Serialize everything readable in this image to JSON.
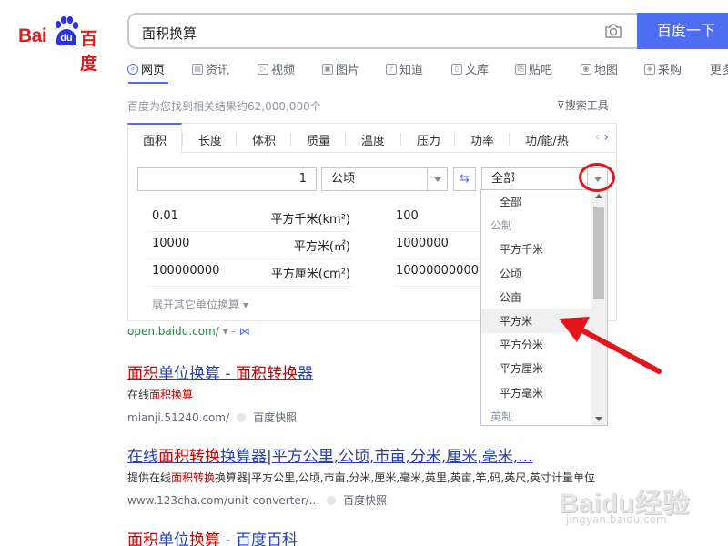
{
  "logo": {
    "bai": "Bai",
    "du": "du",
    "cn": "百度"
  },
  "search": {
    "query": "面积换算",
    "button": "百度一下"
  },
  "nav": [
    {
      "label": "网页",
      "active": true
    },
    {
      "label": "资讯"
    },
    {
      "label": "视频"
    },
    {
      "label": "图片"
    },
    {
      "label": "知道"
    },
    {
      "label": "文库"
    },
    {
      "label": "贴吧"
    },
    {
      "label": "地图"
    },
    {
      "label": "采购"
    },
    {
      "label": "更多"
    }
  ],
  "result_count": "百度为您找到相关结果约62,000,000个",
  "search_tools": "搜索工具",
  "converter": {
    "tabs": [
      "面积",
      "长度",
      "体积",
      "质量",
      "温度",
      "压力",
      "功率",
      "功/能/热"
    ],
    "input_value": "1",
    "from_unit": "公顷",
    "to_unit": "全部",
    "rows": [
      {
        "v1": "0.01",
        "u1": "平方千米(km²)",
        "v2": "100"
      },
      {
        "v1": "10000",
        "u1": "平方米(㎡)",
        "v2": "1000000"
      },
      {
        "v1": "100000000",
        "u1": "平方厘米(cm²)",
        "v2": "10000000000"
      }
    ],
    "expand": "展开其它单位换算"
  },
  "dropdown": {
    "items": [
      {
        "label": "全部",
        "type": "item"
      },
      {
        "label": "公制",
        "type": "group"
      },
      {
        "label": "平方千米",
        "type": "item"
      },
      {
        "label": "公顷",
        "type": "item"
      },
      {
        "label": "公亩",
        "type": "item"
      },
      {
        "label": "平方米",
        "type": "item",
        "hover": true
      },
      {
        "label": "平方分米",
        "type": "item"
      },
      {
        "label": "平方厘米",
        "type": "item"
      },
      {
        "label": "平方毫米",
        "type": "item"
      },
      {
        "label": "英制",
        "type": "group"
      }
    ]
  },
  "open_link": "open.baidu.com/",
  "results": [
    {
      "title_parts": [
        [
          "面积",
          true
        ],
        [
          "单位换算 - ",
          false
        ],
        [
          "面积",
          true
        ],
        [
          "转换",
          true
        ],
        [
          "器",
          false
        ]
      ],
      "desc_parts": [
        [
          "在线",
          false
        ],
        [
          "面积换算",
          true
        ]
      ],
      "url": "mianji.51240.com/",
      "kuaizhao": "百度快照"
    },
    {
      "title_parts": [
        [
          "在线",
          false
        ],
        [
          "面积转换",
          true
        ],
        [
          "换算器|平方公里,公顷,市亩,分米,厘米,毫米,...",
          false
        ]
      ],
      "desc_parts": [
        [
          "提供在线",
          false
        ],
        [
          "面积转换",
          true
        ],
        [
          "换算器|平方公里,公顷,市亩,分米,厘米,毫米,英里,英亩,竿,码,英尺,英寸计量单位",
          false
        ]
      ],
      "url": "www.123cha.com/unit-converter/...",
      "kuaizhao": "百度快照"
    },
    {
      "title_parts": [
        [
          "面积",
          true
        ],
        [
          "单位",
          false
        ],
        [
          "换算",
          true
        ],
        [
          " - 百度百科",
          false
        ]
      ]
    }
  ],
  "watermark": {
    "line1": "Baidu经验",
    "line2": "jingyan.baidu.com"
  },
  "colors": {
    "brand_red": "#de1e1e",
    "brand_blue": "#4e6ef2",
    "link": "#2440b3",
    "highlight": "#c00",
    "annotation_red": "#e3141b"
  }
}
